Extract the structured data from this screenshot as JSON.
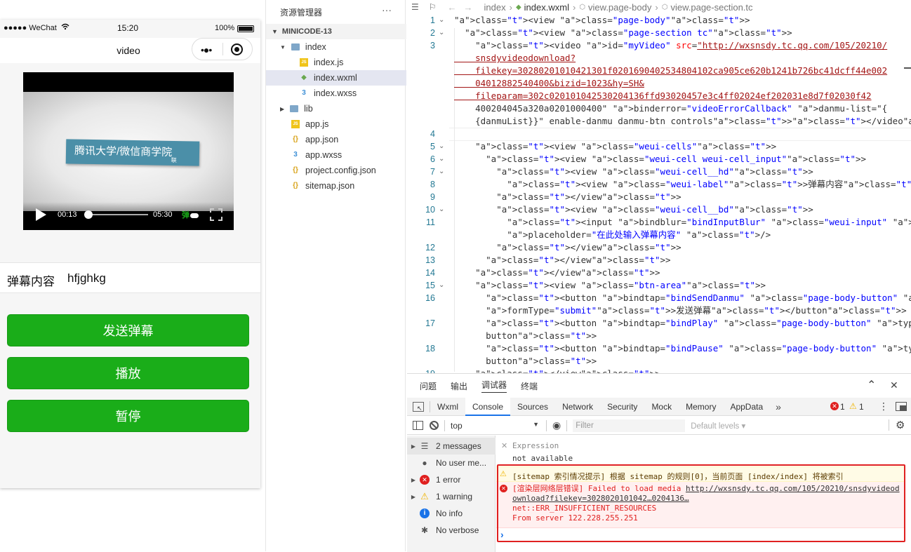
{
  "simulator": {
    "status": {
      "signal": "●●●●● WeChat",
      "time": "15:20",
      "battery": "100%"
    },
    "nav_title": "video",
    "video": {
      "overlay_text": "腾讯大学/微信商学院",
      "overlay_sub": "联",
      "current_time": "00:13",
      "duration": "05:30",
      "danmu_label": "弹",
      "progress": 0.04
    },
    "danmu_row": {
      "label": "弹幕内容",
      "value": "hfjghkg"
    },
    "buttons": [
      "发送弹幕",
      "播放",
      "暂停"
    ]
  },
  "explorer": {
    "title": "资源管理器",
    "more": "···",
    "project": "MINICODE-13",
    "items": [
      {
        "name": "index",
        "type": "folder",
        "icon": "folder-open-icon"
      },
      {
        "name": "index.js",
        "type": "js",
        "icon": "js-file-icon"
      },
      {
        "name": "index.wxml",
        "type": "wxml",
        "icon": "wxml-file-icon",
        "selected": true
      },
      {
        "name": "index.wxss",
        "type": "wxss",
        "icon": "wxss-file-icon"
      },
      {
        "name": "lib",
        "type": "folder",
        "icon": "folder-icon"
      },
      {
        "name": "app.js",
        "type": "js",
        "icon": "js-file-icon"
      },
      {
        "name": "app.json",
        "type": "json",
        "icon": "json-file-icon"
      },
      {
        "name": "app.wxss",
        "type": "wxss",
        "icon": "wxss-file-icon"
      },
      {
        "name": "project.config.json",
        "type": "json",
        "icon": "json-file-icon"
      },
      {
        "name": "sitemap.json",
        "type": "json",
        "icon": "json-file-icon"
      }
    ],
    "icon_colors": {
      "folder": "#7fa7c9",
      "js": "#f0c419",
      "wxml": "#6aa84f",
      "wxss": "#3d8fd6",
      "json": "#d8a31a"
    }
  },
  "editor": {
    "breadcrumb": [
      "index",
      "index.wxml",
      "view.page-body",
      "view.page-section.tc"
    ],
    "lines": [
      {
        "n": "1",
        "fold": true,
        "t": "<view class=\"page-body\">"
      },
      {
        "n": "2",
        "fold": true,
        "t": "  <view class=\"page-section tc\">"
      },
      {
        "n": "3",
        "t": "    <video id=\"myVideo\" src=\"http://wxsnsdy.tc.qq.com/105/20210/"
      },
      {
        "n": "",
        "t": "    snsdyvideodownload?"
      },
      {
        "n": "",
        "t": "    filekey=30280201010421301f0201690402534804102ca905ce620b1241b726bc41dcff44e002"
      },
      {
        "n": "",
        "t": "    04012882540400&bizid=1023&hy=SH&"
      },
      {
        "n": "",
        "t": "    fileparam=302c020101042530204136ffd93020457e3c4ff02024ef202031e8d7f02030f42"
      },
      {
        "n": "",
        "t": "    400204045a320a0201000400\" binderror=\"videoErrorCallback\" danmu-list=\"{"
      },
      {
        "n": "",
        "t": "    {danmuList}}\" enable-danmu danmu-btn controls></video>"
      },
      {
        "n": "4",
        "t": ""
      },
      {
        "n": "5",
        "fold": true,
        "t": "    <view class=\"weui-cells\">"
      },
      {
        "n": "6",
        "fold": true,
        "t": "      <view class=\"weui-cell weui-cell_input\">"
      },
      {
        "n": "7",
        "fold": true,
        "t": "        <view class=\"weui-cell__hd\">"
      },
      {
        "n": "8",
        "t": "          <view class=\"weui-label\">弹幕内容</view>"
      },
      {
        "n": "9",
        "t": "        </view>"
      },
      {
        "n": "10",
        "fold": true,
        "t": "        <view class=\"weui-cell__bd\">"
      },
      {
        "n": "11",
        "t": "          <input bindblur=\"bindInputBlur\" class=\"weui-input\" type=\"text\""
      },
      {
        "n": "",
        "t": "          placeholder=\"在此处输入弹幕内容\" />"
      },
      {
        "n": "12",
        "t": "        </view>"
      },
      {
        "n": "13",
        "t": "      </view>"
      },
      {
        "n": "14",
        "t": "    </view>"
      },
      {
        "n": "15",
        "fold": true,
        "t": "    <view class=\"btn-area\">"
      },
      {
        "n": "16",
        "t": "      <button bindtap=\"bindSendDanmu\" class=\"page-body-button\" type=\"primary\""
      },
      {
        "n": "",
        "t": "      formType=\"submit\">发送弹幕</button>"
      },
      {
        "n": "17",
        "t": "      <button bindtap=\"bindPlay\" class=\"page-body-button\" type=\"primary\">播放</"
      },
      {
        "n": "",
        "t": "      button>"
      },
      {
        "n": "18",
        "t": "      <button bindtap=\"bindPause\" class=\"page-body-button\" type=\"primary\">暂停</"
      },
      {
        "n": "",
        "t": "      button>"
      },
      {
        "n": "19",
        "t": "    </view>"
      }
    ]
  },
  "devtools": {
    "top_tabs": [
      "问题",
      "输出",
      "调试器",
      "终端"
    ],
    "active_top_tab": "调试器",
    "panel_tabs": [
      "Wxml",
      "Console",
      "Sources",
      "Network",
      "Security",
      "Mock",
      "Memory",
      "AppData"
    ],
    "active_panel_tab": "Console",
    "more_tabs": "»",
    "error_count": "1",
    "warning_count": "1",
    "context": "top",
    "filter_placeholder": "Filter",
    "levels": "Default levels ▾",
    "sidebar": [
      {
        "label": "2 messages",
        "icon": "list-icon",
        "expand": true
      },
      {
        "label": "No user me...",
        "icon": "user-icon",
        "expand": false
      },
      {
        "label": "1 error",
        "icon": "error-icon",
        "expand": true
      },
      {
        "label": "1 warning",
        "icon": "warning-icon",
        "expand": true
      },
      {
        "label": "No info",
        "icon": "info-icon",
        "expand": false
      },
      {
        "label": "No verbose",
        "icon": "bug-icon",
        "expand": false
      }
    ],
    "expression": {
      "label": "Expression",
      "value": "not available"
    },
    "warning_msg": "[sitemap 索引情况提示] 根据 sitemap 的规则[0]，当前页面 [index/index] 将被索引",
    "error_msg": {
      "prefix": "[渲染层网络层错误] Failed to load media ",
      "url": "http://wxsnsdy.tc.qq.com/105/20210/snsdyvideodownload?filekey=3028020101042…0204136…",
      "line2": "net::ERR_INSUFFICIENT_RESOURCES",
      "line3": "From server 122.228.255.251"
    },
    "prompt": "›",
    "colors": {
      "error": "#e0201f",
      "warning": "#f0b400",
      "highlight_box": "#e02020",
      "accent": "#1a73e8"
    }
  }
}
